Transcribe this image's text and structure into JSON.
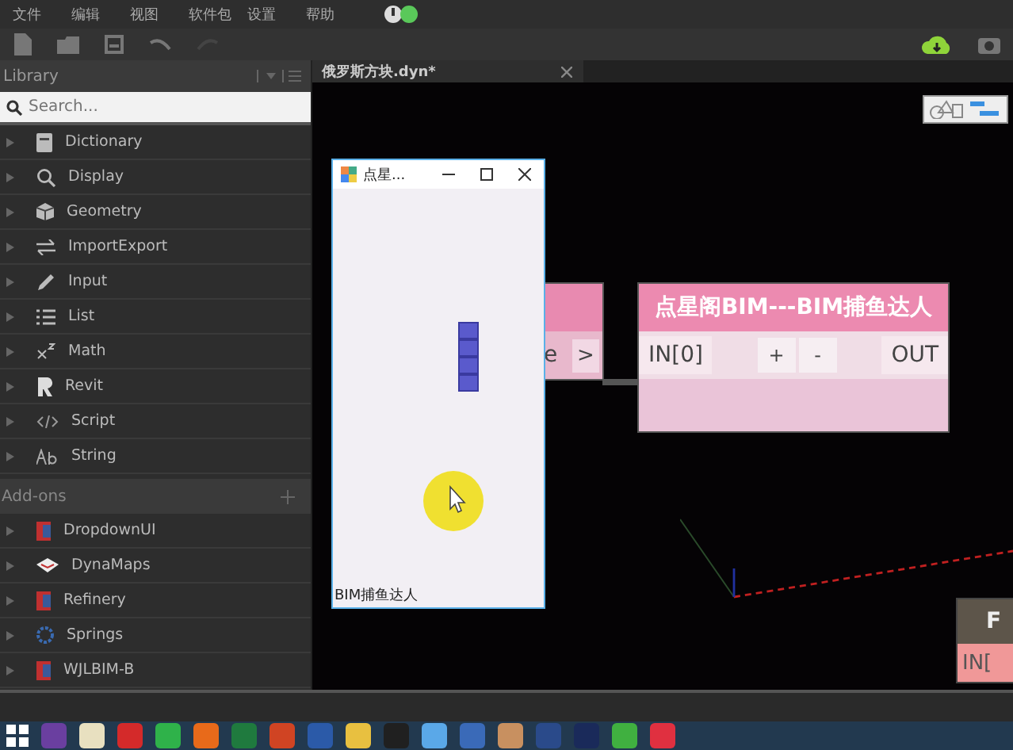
{
  "menu": [
    "文件",
    "编辑",
    "视图",
    "软件包",
    "设置",
    "帮助"
  ],
  "library": {
    "title": "Library",
    "search": {
      "placeholder": "Search..."
    },
    "categories": [
      {
        "label": "Dictionary",
        "kind": "book"
      },
      {
        "label": "Display",
        "kind": "search"
      },
      {
        "label": "Geometry",
        "kind": "cube"
      },
      {
        "label": "ImportExport",
        "kind": "arrows"
      },
      {
        "label": "Input",
        "kind": "pencil"
      },
      {
        "label": "List",
        "kind": "list"
      },
      {
        "label": "Math",
        "kind": "math"
      },
      {
        "label": "Revit",
        "kind": "revit"
      },
      {
        "label": "Script",
        "kind": "code"
      },
      {
        "label": "String",
        "kind": "string"
      }
    ],
    "addons_title": "Add-ons",
    "addons": [
      {
        "label": "DropdownUI",
        "kind": "package"
      },
      {
        "label": "DynaMaps",
        "kind": "map"
      },
      {
        "label": "Refinery",
        "kind": "package"
      },
      {
        "label": "Springs",
        "kind": "gear"
      },
      {
        "label": "WJLBIM-B",
        "kind": "package"
      }
    ]
  },
  "tab": {
    "title": "俄罗斯方块.dyn*"
  },
  "partial_node": {
    "port": "e",
    "output": ">"
  },
  "node": {
    "title": "点星阁BIM---BIM捕鱼达人",
    "input": "IN[0]",
    "add": "+",
    "remove": "-",
    "output": "OUT"
  },
  "corner_node": {
    "title": "F",
    "input": "IN["
  },
  "game_window": {
    "title": "点星...",
    "status": "BIM捕鱼达人"
  }
}
